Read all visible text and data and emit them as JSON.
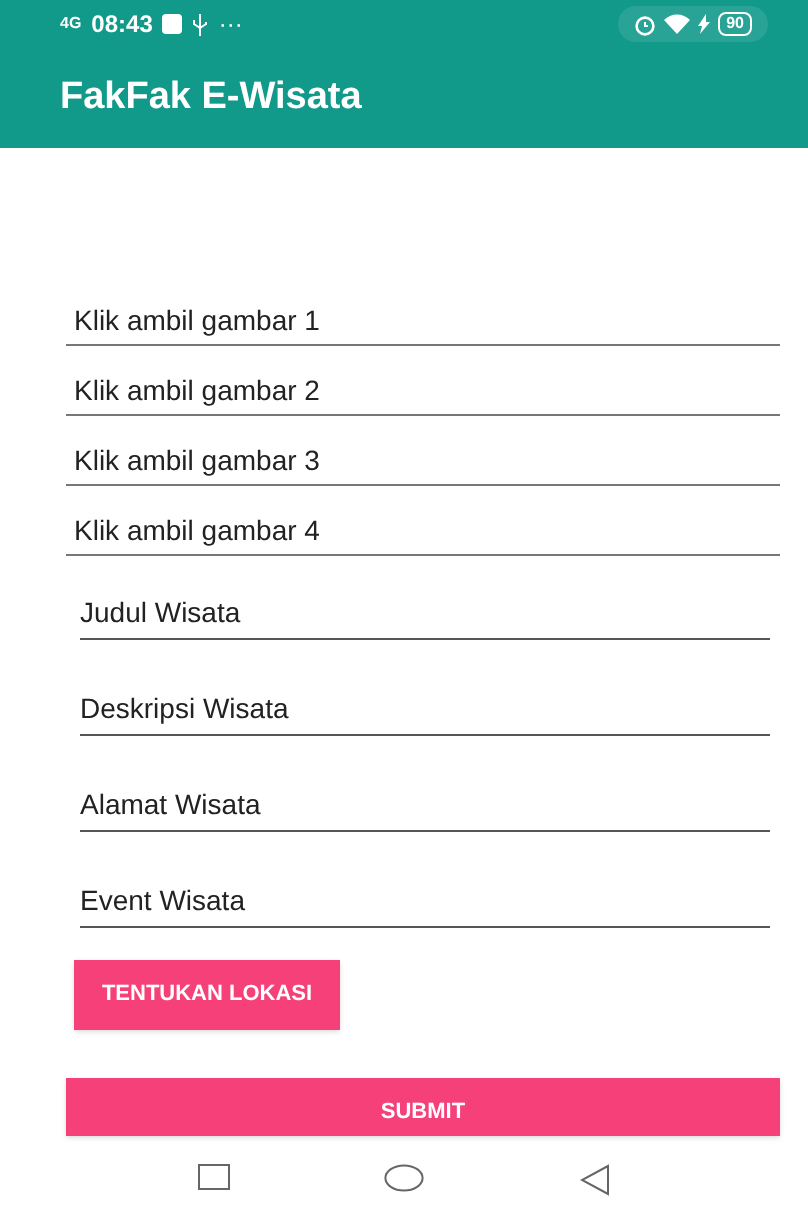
{
  "status_bar": {
    "network": "4G",
    "time": "08:43",
    "more": "···",
    "battery": "90"
  },
  "app_bar": {
    "title": "FakFak E-Wisata"
  },
  "image_pickers": [
    "Klik ambil gambar 1",
    "Klik ambil gambar 2",
    "Klik ambil gambar 3",
    "Klik ambil gambar 4"
  ],
  "fields": [
    {
      "placeholder": "Judul Wisata"
    },
    {
      "placeholder": "Deskripsi Wisata"
    },
    {
      "placeholder": "Alamat Wisata"
    },
    {
      "placeholder": "Event Wisata"
    }
  ],
  "location_button": "TENTUKAN LOKASI",
  "submit_button": "SUBMIT"
}
